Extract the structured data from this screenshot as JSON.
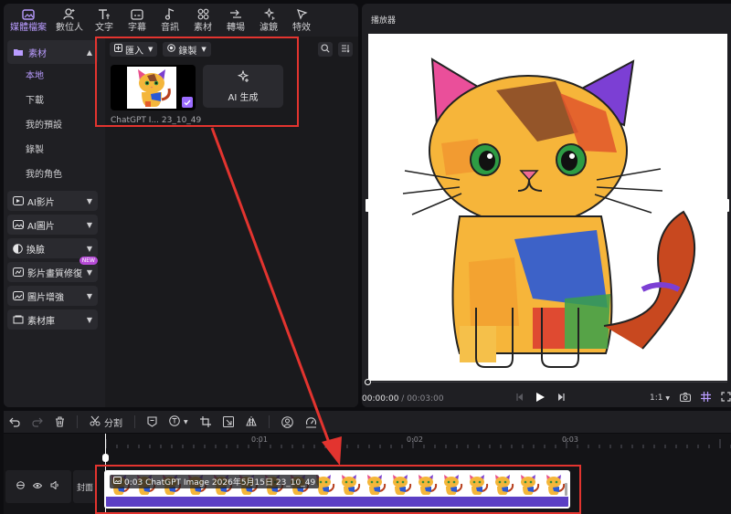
{
  "toptabs": [
    {
      "label": "媒體檔案",
      "icon": "media-icon"
    },
    {
      "label": "數位人",
      "icon": "avatar-icon"
    },
    {
      "label": "文字",
      "icon": "text-icon"
    },
    {
      "label": "字幕",
      "icon": "caption-icon"
    },
    {
      "label": "音訊",
      "icon": "audio-icon"
    },
    {
      "label": "素材",
      "icon": "assets-icon"
    },
    {
      "label": "轉場",
      "icon": "transition-icon"
    },
    {
      "label": "濾鏡",
      "icon": "filter-icon"
    },
    {
      "label": "特效",
      "icon": "effects-icon"
    }
  ],
  "sidebar": {
    "section": "素材",
    "subitems": [
      "本地",
      "下載",
      "我的預設",
      "錄製",
      "我的角色"
    ],
    "categories": [
      {
        "label": "AI影片"
      },
      {
        "label": "AI圖片"
      },
      {
        "label": "換臉"
      },
      {
        "label": "影片畫質修復",
        "badge": "NEW"
      },
      {
        "label": "圖片增強"
      },
      {
        "label": "素材庫"
      }
    ]
  },
  "media": {
    "import_label": "匯入",
    "record_label": "錄製",
    "thumb_name": "ChatGPT I... 23_10_49",
    "ai_label": "AI 生成"
  },
  "player": {
    "title": "播放器",
    "current_time": "00:00:00",
    "total_time": "/ 00:03:00",
    "ratio": "1:1"
  },
  "timeline": {
    "split_label": "分割",
    "ticks": [
      "0:01",
      "0:02",
      "0:03"
    ],
    "cover_label": "封面",
    "clip_label": "0:03  ChatGPT Image 2026年5月15日 23_10_49",
    "frame_count": 18
  },
  "colors": {
    "accent": "#b99cff",
    "highlight_box": "#e3342f",
    "clip_bar": "#5b3fc4"
  }
}
